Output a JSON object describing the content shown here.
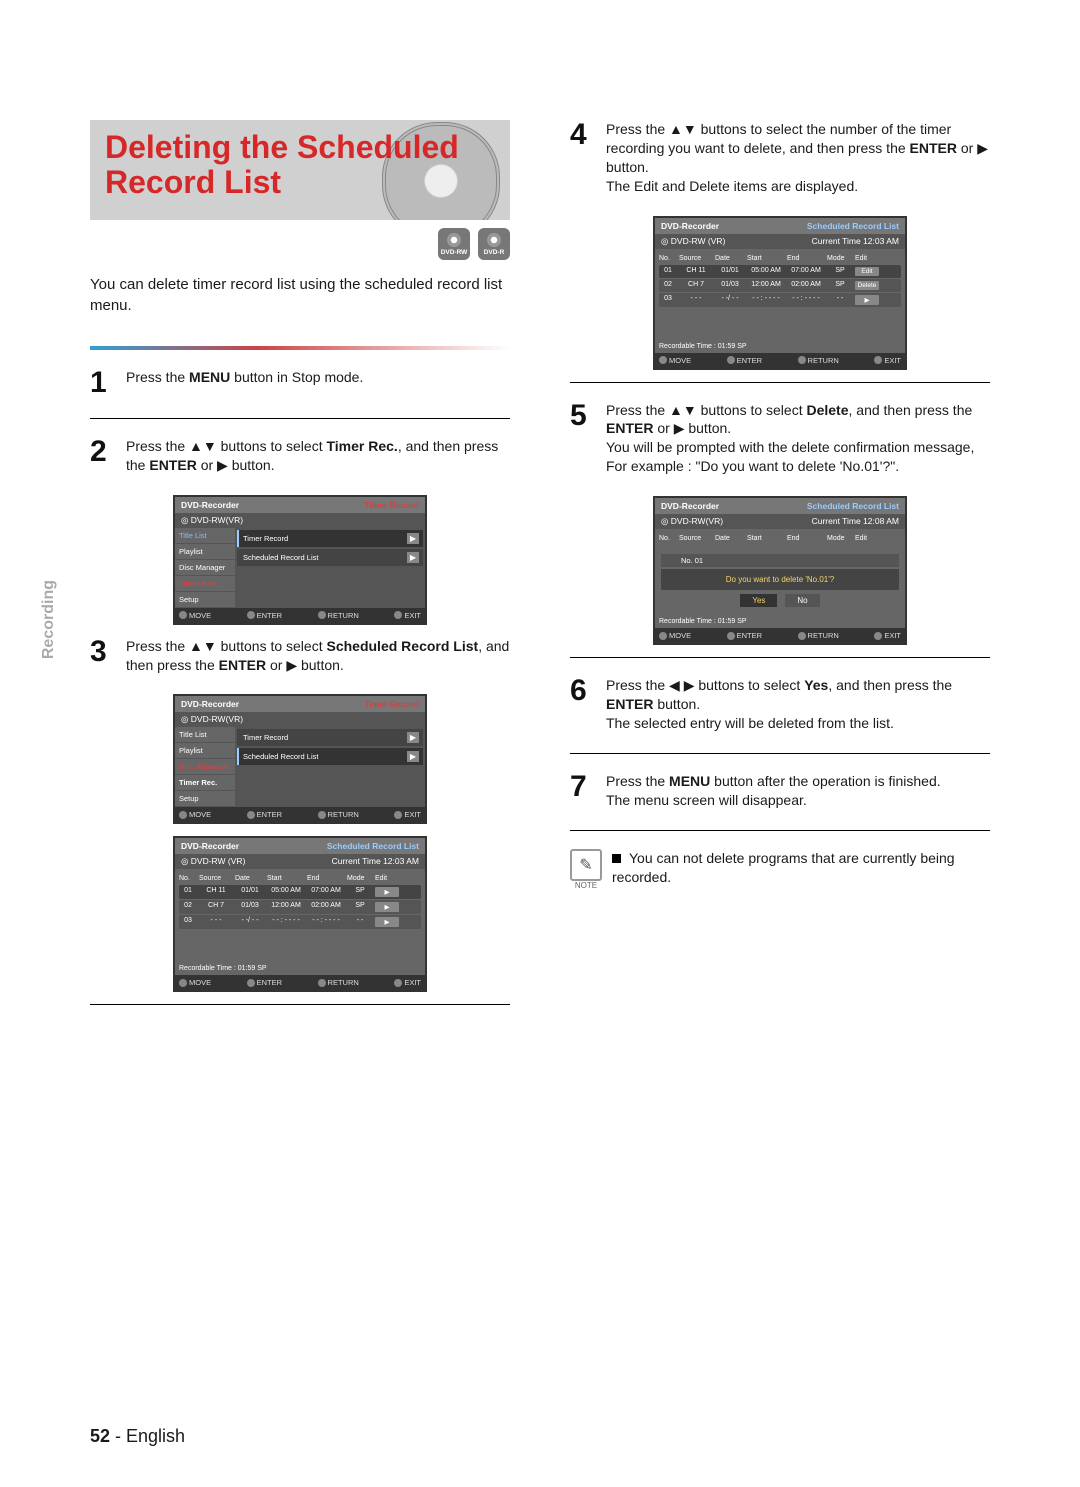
{
  "tab": "Recording",
  "page_number": "52",
  "page_lang": "English",
  "title": "Deleting the Scheduled Record List",
  "badges": [
    {
      "label": "DVD-RW"
    },
    {
      "label": "DVD-R"
    }
  ],
  "intro": "You can delete timer record list using the scheduled record list menu.",
  "steps": {
    "s1": {
      "num": "1",
      "pre": "Press the ",
      "b1": "MENU",
      "post": " button in Stop mode."
    },
    "s2": {
      "num": "2",
      "pre": "Press the ",
      "sym": "▲▼",
      "mid": " buttons to select ",
      "b1": "Timer Rec.",
      "mid2": ", and then press the ",
      "b2": "ENTER",
      "mid3": " or ",
      "sym2": "▶",
      "post": " button."
    },
    "s3": {
      "num": "3",
      "pre": "Press the ",
      "sym": "▲▼",
      "mid": " buttons to select ",
      "b1": "Scheduled Record List",
      "mid2": ", and then press the ",
      "b2": "ENTER",
      "mid3": " or ",
      "sym2": "▶",
      "post": " button."
    },
    "s4": {
      "num": "4",
      "pre": "Press the ",
      "sym": "▲▼",
      "mid": " buttons to select the number of the timer recording you want to delete, and then press the ",
      "b1": "ENTER",
      "mid2": " or ",
      "sym2": "▶",
      "post": " button.",
      "after": "The Edit and Delete items are displayed."
    },
    "s5": {
      "num": "5",
      "pre": "Press the ",
      "sym": "▲▼",
      "mid": " buttons to select ",
      "b1": "Delete",
      "mid2": ", and then press the ",
      "b2": "ENTER",
      "mid3": " or ",
      "sym2": "▶",
      "post": " button.",
      "after": "You will be prompted with the delete confirmation message, For example : \"Do you want to delete 'No.01'?\"."
    },
    "s6": {
      "num": "6",
      "pre": "Press the ",
      "sym": "◀ ▶",
      "mid": " buttons to select ",
      "b1": "Yes",
      "mid2": ", and then press the ",
      "b2": "ENTER",
      "post": " button.",
      "after": "The selected entry will be deleted from the list."
    },
    "s7": {
      "num": "7",
      "pre": "Press the ",
      "b1": "MENU",
      "mid": " button after the operation is finished.",
      "after": "The menu screen will disappear."
    }
  },
  "note": {
    "label": "NOTE",
    "text": "You can not delete programs that are currently being recorded."
  },
  "osd_menu": {
    "header_left": "DVD-Recorder",
    "header_right_timer": "Timer Record",
    "sub": "DVD-RW(VR)",
    "items": [
      "Title List",
      "Playlist",
      "Disc Manager",
      "Timer Rec.",
      "Setup"
    ],
    "content_rows": [
      "Timer Record",
      "Scheduled Record List"
    ]
  },
  "osd_list": {
    "header_left": "DVD-Recorder",
    "header_right": "Scheduled Record List",
    "sub_left": "DVD-RW (VR)",
    "time3": "Current Time  12:03 AM",
    "time8": "Current Time  12:08 AM",
    "cols": [
      "No.",
      "Source",
      "Date",
      "Start",
      "End",
      "Mode",
      "Edit"
    ],
    "rows": [
      {
        "no": "01",
        "src": "CH 11",
        "date": "01/01",
        "start": "05:00 AM",
        "end": "07:00 AM",
        "mode": "SP"
      },
      {
        "no": "02",
        "src": "CH 7",
        "date": "01/03",
        "start": "12:00 AM",
        "end": "02:00 AM",
        "mode": "SP"
      },
      {
        "no": "03",
        "src": "- - -",
        "date": "- -/ - -",
        "start": "- - : - - - -",
        "end": "- - : - - - -",
        "mode": "- -"
      }
    ],
    "edit_label": "Edit",
    "delete_label": "Delete",
    "rectime": "Recordable Time : 01:59  SP",
    "footer": [
      "MOVE",
      "ENTER",
      "RETURN",
      "EXIT"
    ]
  },
  "osd_dialog": {
    "no": "No. 01",
    "msg": "Do you want to delete 'No.01'?",
    "yes": "Yes",
    "no_btn": "No"
  }
}
